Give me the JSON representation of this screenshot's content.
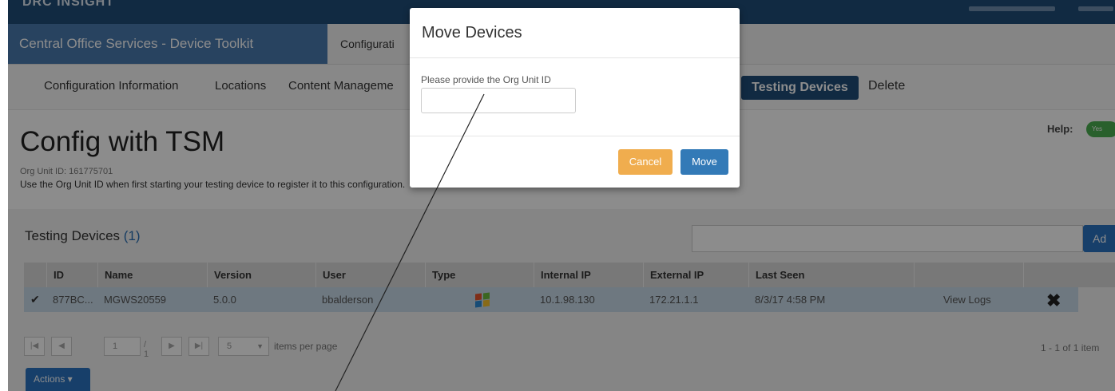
{
  "app": {
    "brand": "DRC INSIGHT",
    "title": "Central Office Services - Device Toolkit",
    "tab_configurations": "Configurati"
  },
  "subnav": {
    "configuration_information": "Configuration Information",
    "locations": "Locations",
    "content_management": "Content Manageme",
    "testing_devices": "Testing Devices",
    "delete": "Delete"
  },
  "page": {
    "title": "Config with TSM",
    "help_label": "Help:",
    "help_toggle": "Yes",
    "org_unit": "Org Unit ID: 161775701",
    "hint": "Use the Org Unit ID when first starting your testing device to register it to this configuration."
  },
  "panel": {
    "title": "Testing Devices",
    "count": "(1)",
    "add_label": "Ad"
  },
  "grid": {
    "columns": [
      "ID",
      "Name",
      "Version",
      "User",
      "Type",
      "Internal IP",
      "External IP",
      "Last Seen"
    ],
    "rows": [
      {
        "id": "877BC...",
        "name": "MGWS20559",
        "version": "5.0.0",
        "user": "bbalderson",
        "type_icon": "windows-icon",
        "internal_ip": "10.1.98.130",
        "external_ip": "172.21.1.1",
        "last_seen": "8/3/17 4:58 PM",
        "view_logs": "View Logs"
      }
    ]
  },
  "pager": {
    "first": "|◀",
    "prev": "◀",
    "page_value": "1",
    "of_pages": "/ 1",
    "next": "▶",
    "last": "▶|",
    "page_size": "5",
    "items_per_page": "items per page",
    "summary": "1 - 1 of 1 item"
  },
  "actions_label": "Actions ▾",
  "modal": {
    "title": "Move Devices",
    "label": "Please provide the Org Unit ID",
    "input_value": "",
    "cancel": "Cancel",
    "move": "Move"
  },
  "colors": {
    "brand_blue": "#1f4e79",
    "primary": "#337ab7",
    "warning": "#f0ad4e",
    "selected_row": "#c9dbea"
  }
}
